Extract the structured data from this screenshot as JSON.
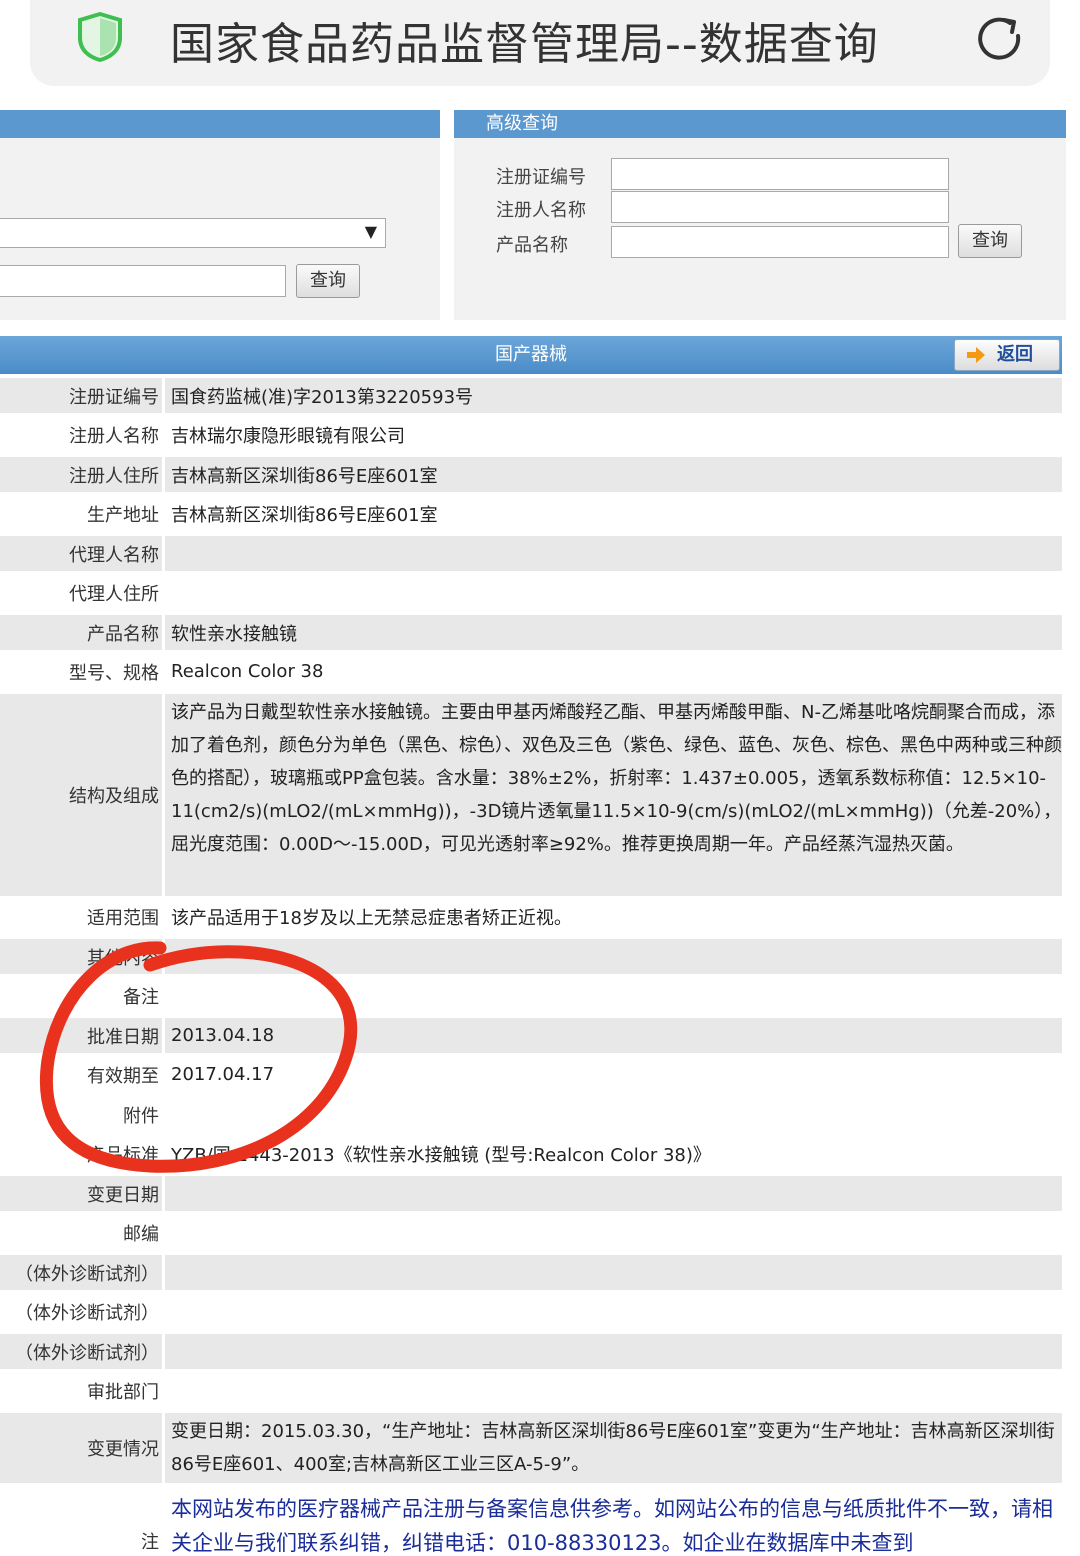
{
  "browser": {
    "title": "国家食品药品监督管理局--数据查询",
    "icons": {
      "site": "shield-icon",
      "reload": "reload-icon"
    }
  },
  "quick_query": {
    "search_button": "查询"
  },
  "advanced_query": {
    "heading": "高级查询",
    "fields": [
      {
        "label": "注册证编号",
        "value": ""
      },
      {
        "label": "注册人名称",
        "value": ""
      },
      {
        "label": "产品名称",
        "value": ""
      }
    ],
    "search_button": "查询"
  },
  "detail": {
    "heading": "国产器械",
    "back_label": "返回",
    "rows": [
      {
        "label": "注册证编号",
        "value": "国食药监械(准)字2013第3220593号"
      },
      {
        "label": "注册人名称",
        "value": "吉林瑞尔康隐形眼镜有限公司"
      },
      {
        "label": "注册人住所",
        "value": "吉林高新区深圳街86号E座601室"
      },
      {
        "label": "生产地址",
        "value": "吉林高新区深圳街86号E座601室"
      },
      {
        "label": "代理人名称",
        "value": ""
      },
      {
        "label": "代理人住所",
        "value": ""
      },
      {
        "label": "产品名称",
        "value": "软性亲水接触镜"
      },
      {
        "label": "型号、规格",
        "value": "Realcon Color 38"
      },
      {
        "label": "结构及组成",
        "value": "该产品为日戴型软性亲水接触镜。主要由甲基丙烯酸羟乙酯、甲基丙烯酸甲酯、N-乙烯基吡咯烷酮聚合而成，添加了着色剂，颜色分为单色（黑色、棕色）、双色及三色（紫色、绿色、蓝色、灰色、棕色、黑色中两种或三种颜色的搭配），玻璃瓶或PP盒包装。含水量：38%±2%，折射率：1.437±0.005，透氧系数标称值：12.5×10-11(cm2/s)(mLO2/(mL×mmHg))，-3D镜片透氧量11.5×10-9(cm/s)(mLO2/(mL×mmHg))（允差-20%），屈光度范围：0.00D～-15.00D，可见光透射率≥92%。推荐更换周期一年。产品经蒸汽湿热灭菌。"
      },
      {
        "label": "适用范围",
        "value": "该产品适用于18岁及以上无禁忌症患者矫正近视。"
      },
      {
        "label": "其他内容",
        "value": ""
      },
      {
        "label": "备注",
        "value": ""
      },
      {
        "label": "批准日期",
        "value": "2013.04.18"
      },
      {
        "label": "有效期至",
        "value": "2017.04.17"
      },
      {
        "label": "附件",
        "value": ""
      },
      {
        "label": "产品标准",
        "value": "YZB/国 1443-2013《软性亲水接触镜 (型号:Realcon Color 38)》"
      },
      {
        "label": "变更日期",
        "value": ""
      },
      {
        "label": "邮编",
        "value": ""
      },
      {
        "label": "（体外诊断试剂）",
        "value": ""
      },
      {
        "label": "（体外诊断试剂）",
        "value": ""
      },
      {
        "label": "（体外诊断试剂）",
        "value": ""
      },
      {
        "label": "审批部门",
        "value": ""
      },
      {
        "label": "变更情况",
        "value": "变更日期：2015.03.30，“生产地址：吉林高新区深圳街86号E座601室”变更为“生产地址：吉林高新区深圳街86号E座601、400室;吉林高新区工业三区A-5-9”。"
      },
      {
        "label": "注",
        "value": "本网站发布的医疗器械产品注册与备案信息供参考。如网站公布的信息与纸质批件不一致，请相关企业与我们联系纠错，纠错电话：010-88330123。如企业在数据库中未查到"
      }
    ]
  },
  "colors": {
    "header_blue": "#5a98cf",
    "annotation_red": "#e8321e",
    "notice_blue": "#1a2d99"
  }
}
